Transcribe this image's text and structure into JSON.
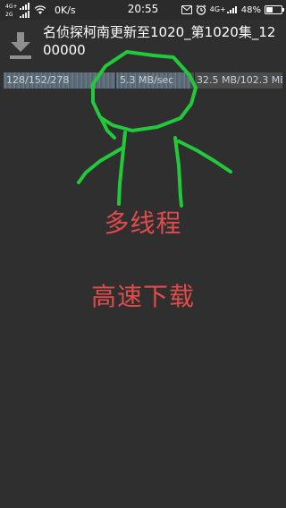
{
  "status_bar": {
    "sim1_label": "4G+",
    "sim2_label": "2G",
    "net_speed": "0K/s",
    "time": "20:55",
    "right_net_label": "4G+",
    "battery_percent": "48%",
    "battery_level": 0.48,
    "icons": [
      "signal-icon",
      "wifi-icon",
      "message-icon",
      "alarm-icon",
      "signal-icon",
      "battery-icon"
    ]
  },
  "download": {
    "icon": "download-icon",
    "title": "名侦探柯南更新至1020_第1020集_1200000",
    "progress_fraction": 0.67,
    "segments": "128/152/278",
    "speed": "5.3 MB/sec",
    "size": "32.5 MB/102.3 MB"
  },
  "annotation": {
    "line1": "多线程",
    "line2": "高速下载",
    "color_text": "#e14b4b",
    "color_drawing": "#22c93a"
  }
}
